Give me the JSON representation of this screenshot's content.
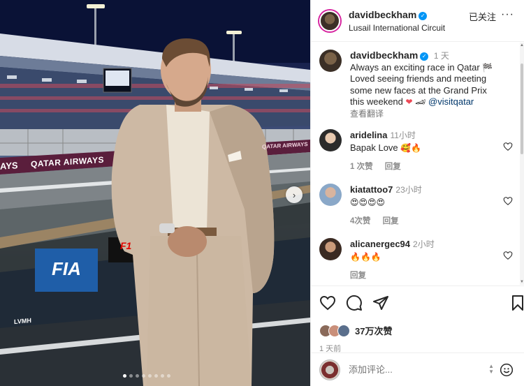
{
  "post": {
    "username": "davidbeckham",
    "location": "Lusail International Circuit",
    "follow_label": "已关注",
    "more_label": "···"
  },
  "photo": {
    "billboard_left": "AYS",
    "billboard_main": "QATAR AIRWAYS",
    "billboard_right": "QATAR AIRWAYS",
    "fia_label": "FIA",
    "f1_label": "F1",
    "lvmh_label": "LVMH",
    "next_icon": "chevron-right-icon",
    "slides": 8,
    "active_slide": 0
  },
  "caption": {
    "username": "davidbeckham",
    "time": "1 天",
    "line1": "Always an exciting race in Qatar ",
    "flag": "🏁",
    "line2": "Loved seeing friends and meeting",
    "line3": "some new faces at the Grand Prix",
    "line4": "this weekend ",
    "heart": "❤",
    "car": "🏎",
    "mention": "@visitqatar",
    "translate": "查看翻译"
  },
  "comments": [
    {
      "username": "aridelina",
      "time": "11小时",
      "text": "Bapak Love ",
      "emoji": "🥰🔥",
      "likes": "1 次赞",
      "reply": "回复"
    },
    {
      "username": "kiatattoo7",
      "time": "23小时",
      "text": "",
      "emoji": "😍😍😍😍",
      "likes": "4次赞",
      "reply": "回复"
    },
    {
      "username": "alicanergec94",
      "time": "2小时",
      "text": "",
      "emoji": "🔥🔥🔥",
      "likes": "",
      "reply": "回复"
    }
  ],
  "actions": {
    "likes_count": "37万次赞",
    "posted_ago": "1 天前"
  },
  "add_comment": {
    "placeholder": "添加评论..."
  },
  "colors": {
    "verified": "#0095f6",
    "heart": "#ed4956",
    "mention": "#00376b",
    "muted": "#8e8e8e"
  }
}
